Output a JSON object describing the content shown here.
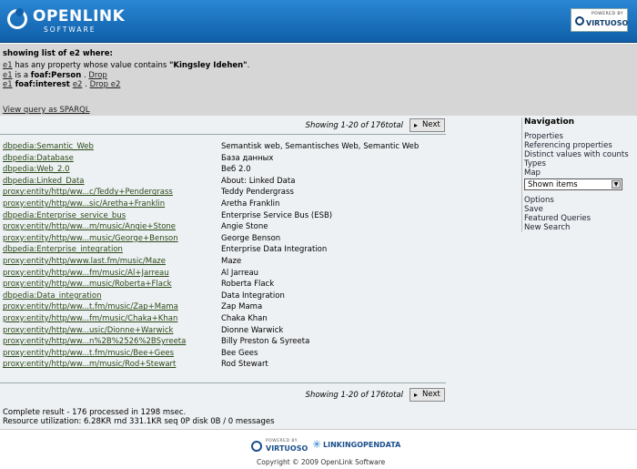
{
  "header": {
    "logo_name": "OPENLINK",
    "logo_sub": "SOFTWARE",
    "badge_powered": "POWERED BY",
    "badge_name": "VIRTUOSO"
  },
  "query": {
    "title": "showing list of e2 where:",
    "line1": {
      "var": "e1",
      "text": " has any property whose value contains ",
      "value": "\"Kingsley Idehen\"",
      "end": "."
    },
    "line2": {
      "var": "e1",
      "text": " is a ",
      "type": "foaf:Person",
      "sep": " . ",
      "drop": "Drop"
    },
    "line3": {
      "var": "e1",
      "prop": " foaf:interest ",
      "var2": "e2",
      "sep": " . ",
      "drop": "Drop e2"
    },
    "sparql_link": "View query as SPARQL"
  },
  "pager": {
    "text": "Showing 1-20 of 176total",
    "next": "Next"
  },
  "results": [
    {
      "link": "dbpedia:Semantic_Web",
      "label": "Semantisk web, Semantisches Web, Semantic Web"
    },
    {
      "link": "dbpedia:Database",
      "label": "База данных"
    },
    {
      "link": "dbpedia:Web_2.0",
      "label": "Веб 2.0"
    },
    {
      "link": "dbpedia:Linked_Data",
      "label": "About: Linked Data"
    },
    {
      "link": "proxy:entity/http/ww...c/Teddy+Pendergrass",
      "label": "Teddy Pendergrass"
    },
    {
      "link": "proxy:entity/http/ww...sic/Aretha+Franklin",
      "label": "Aretha Franklin"
    },
    {
      "link": "dbpedia:Enterprise_service_bus",
      "label": "Enterprise Service Bus (ESB)"
    },
    {
      "link": "proxy:entity/http/ww...m/music/Angie+Stone",
      "label": "Angie Stone"
    },
    {
      "link": "proxy:entity/http/ww...music/George+Benson",
      "label": "George Benson"
    },
    {
      "link": "dbpedia:Enterprise_integration",
      "label": "Enterprise Data Integration"
    },
    {
      "link": "proxy:entity/http/www.last.fm/music/Maze",
      "label": "Maze"
    },
    {
      "link": "proxy:entity/http/ww...fm/music/Al+Jarreau",
      "label": "Al Jarreau"
    },
    {
      "link": "proxy:entity/http/ww...music/Roberta+Flack",
      "label": "Roberta Flack"
    },
    {
      "link": "dbpedia:Data_integration",
      "label": "Data Integration"
    },
    {
      "link": "proxy:entity/http/ww...t.fm/music/Zap+Mama",
      "label": "Zap Mama"
    },
    {
      "link": "proxy:entity/http/ww...fm/music/Chaka+Khan",
      "label": "Chaka Khan"
    },
    {
      "link": "proxy:entity/http/ww...usic/Dionne+Warwick",
      "label": "Dionne Warwick"
    },
    {
      "link": "proxy:entity/http/ww...n%2B%2526%2BSyreeta",
      "label": "Billy Preston & Syreeta"
    },
    {
      "link": "proxy:entity/http/ww...t.fm/music/Bee+Gees",
      "label": "Bee Gees"
    },
    {
      "link": "proxy:entity/http/ww...m/music/Rod+Stewart",
      "label": "Rod Stewart"
    }
  ],
  "status": {
    "line1": "Complete result - 176 processed in 1298 msec.",
    "line2": "Resource utilization: 6.28KR rnd 331.1KR seq 0P disk 0B / 0 messages"
  },
  "nav": {
    "title": "Navigation",
    "links1": [
      "Properties",
      "Referencing properties",
      "Distinct values with counts",
      "Types",
      "Map"
    ],
    "select_value": "Shown items",
    "links2": [
      "Options",
      "Save",
      "Featured Queries",
      "New Search"
    ]
  },
  "footer": {
    "virt_powered": "POWERED BY",
    "virt_name": "VIRTUOSO",
    "lod": "LINKINGOPENDATA",
    "copyright": "Copyright © 2009 OpenLink Software"
  }
}
